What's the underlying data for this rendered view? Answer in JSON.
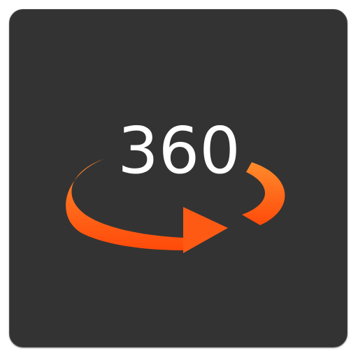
{
  "app_icon": {
    "label": "360",
    "icon": "rotate-360-icon",
    "colors": {
      "tile_background": "#333333",
      "text": "#ffffff",
      "arrow_light": "#ff8a2a",
      "arrow_dark": "#ff4a0a"
    }
  }
}
